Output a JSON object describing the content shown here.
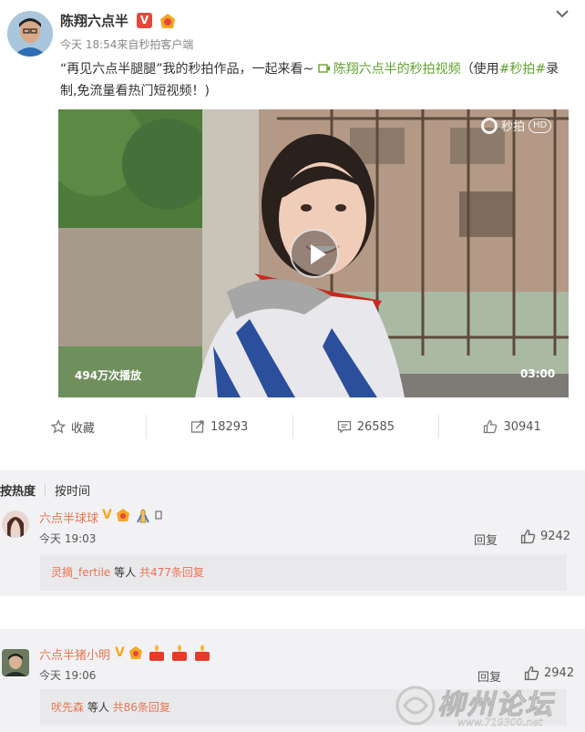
{
  "post": {
    "author": "陈翔六点半",
    "verified_badge": "V",
    "meta": "今天 18:54来自秒拍客户端",
    "text_prefix": "“再见六点半腿腿”我的秒拍作品，一起来看~ ",
    "video_link": "陈翔六点半的秒拍视频",
    "text_mid": "（使用",
    "topic": "#秒拍#",
    "text_suffix": "录制,免流量看热门短视频！)",
    "video": {
      "platform_label": "秒拍",
      "hd_label": "HD",
      "play_count": "494万次播放",
      "duration": "03:00"
    },
    "actions": {
      "favorite": "收藏",
      "repost": "18293",
      "comment": "26585",
      "like": "30941"
    }
  },
  "comments": {
    "sort": {
      "hot": "按热度",
      "time": "按时间"
    },
    "items": [
      {
        "user": "六点半球球",
        "time": "今天 19:03",
        "reply_label": "回复",
        "likes": "9242",
        "reply_preview": {
          "user": "灵摘_fertile",
          "connector": " 等人 ",
          "count_text": "共477条回复"
        }
      },
      {
        "user": "六点半猪小明",
        "time": "今天 19:06",
        "reply_label": "回复",
        "likes": "2942",
        "reply_preview": {
          "user": "吠先森",
          "connector": " 等人 ",
          "count_text": "共86条回复"
        }
      }
    ]
  },
  "watermark": {
    "text": "柳州论坛",
    "url": "www.719300.net"
  },
  "colors": {
    "link": "#60a32e",
    "username": "#eb7350",
    "verified": "#e4483b",
    "gold_v": "#f8a81c"
  },
  "icons": [
    "dropdown-arrow-icon",
    "video-link-icon",
    "star-icon",
    "repost-icon",
    "comment-icon",
    "thumbs-up-icon",
    "play-icon"
  ]
}
